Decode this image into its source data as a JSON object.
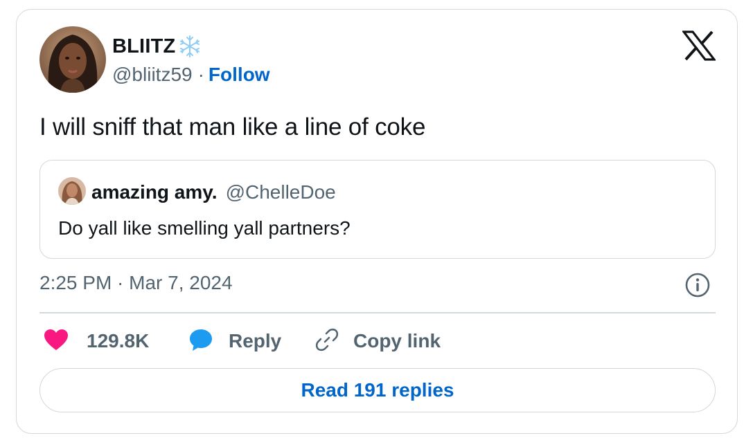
{
  "tweet": {
    "author_name": "BLIITZ",
    "author_handle": "@bliitz59",
    "separator": "·",
    "follow_label": "Follow",
    "text": "I will sniff that man like a line of coke",
    "timestamp": "2:25 PM · Mar 7, 2024"
  },
  "quoted_tweet": {
    "author_name": "amazing amy.",
    "author_handle": "@ChelleDoe",
    "text": "Do yall like smelling yall partners?"
  },
  "actions": {
    "like_count": "129.8K",
    "reply_label": "Reply",
    "copy_label": "Copy link"
  },
  "read_replies_label": "Read 191 replies",
  "icons": {
    "logo": "x-logo-icon",
    "verified_badge": "snowflake-icon",
    "like": "heart-icon",
    "reply": "speech-bubble-icon",
    "copy": "link-icon",
    "info": "info-icon"
  },
  "colors": {
    "link_blue": "#0066cc",
    "like_pink": "#f91880",
    "reply_blue": "#1d9bf0",
    "muted_text": "#536471",
    "border": "#cfd9de",
    "snowflake": "#8ecdf5"
  }
}
